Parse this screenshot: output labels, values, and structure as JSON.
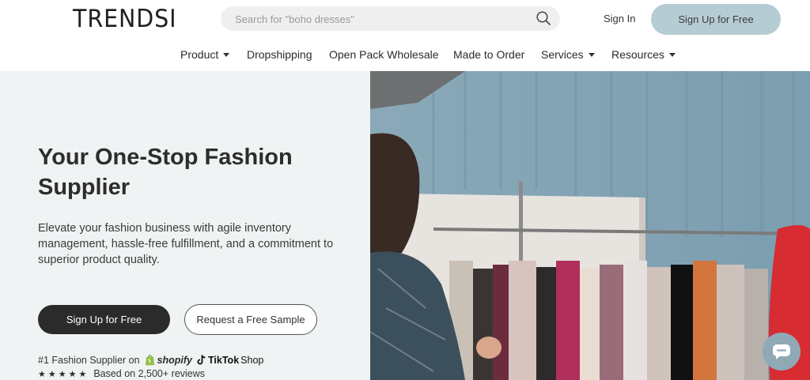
{
  "header": {
    "logo": "TRENDSI",
    "search": {
      "placeholder": "Search for \"boho dresses\"",
      "value": ""
    },
    "sign_in": "Sign In",
    "sign_up": "Sign Up for Free"
  },
  "nav": [
    {
      "label": "Product",
      "dropdown": true
    },
    {
      "label": "Dropshipping",
      "dropdown": false
    },
    {
      "label": "Open Pack Wholesale",
      "dropdown": false
    },
    {
      "label": "Made to Order",
      "dropdown": false
    },
    {
      "label": "Services",
      "dropdown": true
    },
    {
      "label": "Resources",
      "dropdown": true
    }
  ],
  "hero": {
    "title": "Your One-Stop Fashion Supplier",
    "description": "Elevate your fashion business with agile inventory management, hassle-free fulfillment, and a commitment to superior product quality.",
    "primary_cta": "Sign Up for Free",
    "secondary_cta": "Request a Free Sample",
    "trust_prefix": "#1 Fashion Supplier on",
    "shopify": "shopify",
    "tiktok": "TikTok",
    "tiktok_shop": "Shop",
    "rating_stars": "★★★★★",
    "rating_text": "Based on 2,500+ reviews"
  },
  "colors": {
    "accent": "#b6ccd4",
    "dark_button": "#2b2b2b",
    "hero_bg": "#f0f3f3",
    "chat_button": "#8fa9b6"
  },
  "icons": {
    "search": "search-icon",
    "chat": "chat-icon",
    "shopify": "shopify-bag-icon",
    "tiktok": "tiktok-note-icon"
  }
}
